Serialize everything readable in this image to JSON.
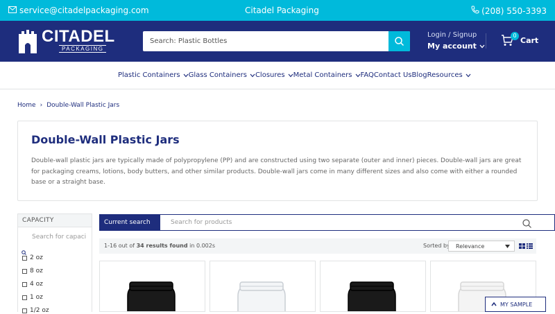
{
  "topbar": {
    "email": "service@citadelpackaging.com",
    "center": "Citadel Packaging",
    "phone": "(208) 550-3393"
  },
  "header": {
    "brand": "CITADEL",
    "brand_sub": "PACKAGING",
    "search_placeholder": "Search: Plastic Bottles",
    "login": "Login / Signup",
    "account": "My account",
    "cart_label": "Cart",
    "cart_count": "0"
  },
  "nav": {
    "items": [
      {
        "label": "Plastic Containers",
        "dropdown": true
      },
      {
        "label": "Glass Containers",
        "dropdown": true
      },
      {
        "label": "Closures",
        "dropdown": true
      },
      {
        "label": "Metal Containers",
        "dropdown": true
      },
      {
        "label": "FAQ",
        "dropdown": false
      },
      {
        "label": "Contact Us",
        "dropdown": false
      },
      {
        "label": "Blog",
        "dropdown": false
      },
      {
        "label": "Resources",
        "dropdown": true
      }
    ]
  },
  "breadcrumb": {
    "home": "Home",
    "separator": "›",
    "current": "Double-Wall Plastic Jars"
  },
  "collection": {
    "title": "Double-Wall Plastic Jars",
    "description": "Double-wall plastic jars are typically made of polypropylene (PP) and are constructed using two separate (outer and inner) pieces.  Double-wall jars are great for packaging creams, lotions, body butters, and other similar products.  Double-wall jars come in many different sizes and also come with either a rounded base or a straight base."
  },
  "filter": {
    "heading": "CAPACITY",
    "search_placeholder": "Search for capaci",
    "options": [
      "2 oz",
      "8 oz",
      "4 oz",
      "1 oz",
      "1/2 oz"
    ]
  },
  "results": {
    "current_search_label": "Current search",
    "search_placeholder": "Search for products",
    "range": "1-16 out of",
    "count": "34 results found",
    "time": "in 0.002s",
    "sort_label": "Sorted by",
    "sort_value": "Relevance"
  },
  "products": [
    {
      "color": "black"
    },
    {
      "color": "clear"
    },
    {
      "color": "black"
    },
    {
      "color": "white"
    }
  ],
  "sample_button": "MY SAMPLE",
  "colors": {
    "topbar": "#00badb",
    "header": "#1e2d7d",
    "accent": "#00badb"
  }
}
